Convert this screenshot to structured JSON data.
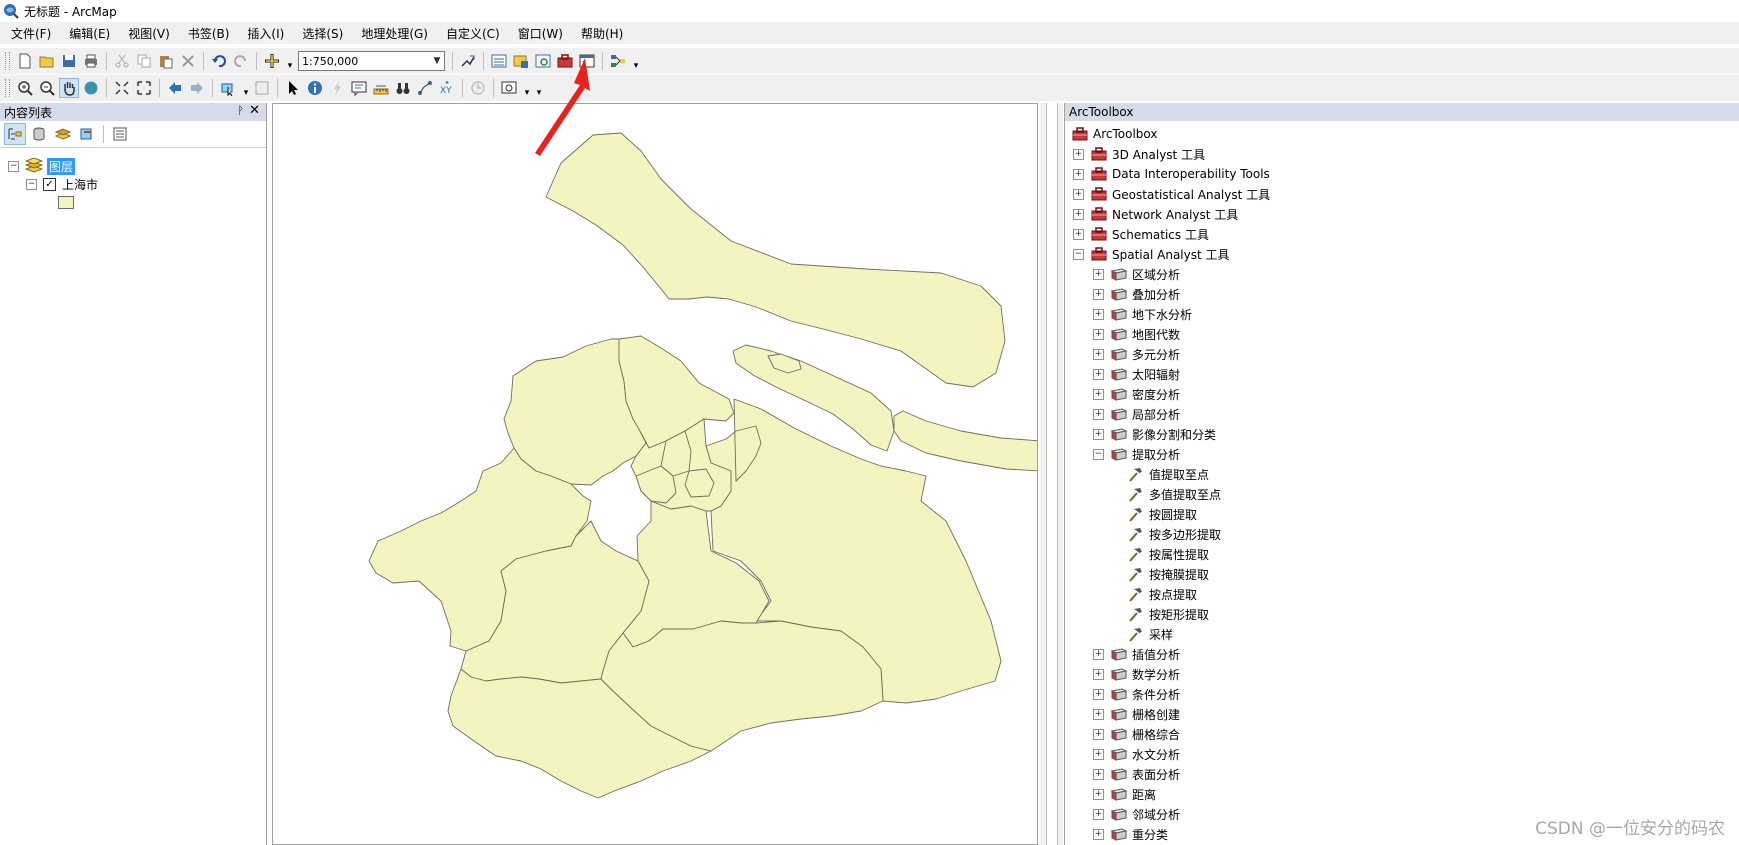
{
  "window": {
    "title": "无标题 - ArcMap"
  },
  "menu": [
    "文件(F)",
    "编辑(E)",
    "视图(V)",
    "书签(B)",
    "插入(I)",
    "选择(S)",
    "地理处理(G)",
    "自定义(C)",
    "窗口(W)",
    "帮助(H)"
  ],
  "toolbar": {
    "scale_value": "1:750,000"
  },
  "toc": {
    "title": "内容列表",
    "root_label": "图层",
    "layer_label": "上海市",
    "layer_checked": true
  },
  "toolbox": {
    "title": "ArcToolbox",
    "root_label": "ArcToolbox",
    "toolsets": [
      {
        "label": "3D Analyst 工具",
        "expanded": false
      },
      {
        "label": "Data Interoperability Tools",
        "expanded": false
      },
      {
        "label": "Geostatistical Analyst 工具",
        "expanded": false
      },
      {
        "label": "Network Analyst 工具",
        "expanded": false
      },
      {
        "label": "Schematics 工具",
        "expanded": false
      },
      {
        "label": "Spatial Analyst 工具",
        "expanded": true
      }
    ],
    "spatial_children": [
      {
        "label": "区域分析",
        "expanded": false
      },
      {
        "label": "叠加分析",
        "expanded": false
      },
      {
        "label": "地下水分析",
        "expanded": false
      },
      {
        "label": "地图代数",
        "expanded": false
      },
      {
        "label": "多元分析",
        "expanded": false
      },
      {
        "label": "太阳辐射",
        "expanded": false
      },
      {
        "label": "密度分析",
        "expanded": false
      },
      {
        "label": "局部分析",
        "expanded": false
      },
      {
        "label": "影像分割和分类",
        "expanded": false
      },
      {
        "label": "提取分析",
        "expanded": true
      }
    ],
    "extraction_tools": [
      "值提取至点",
      "多值提取至点",
      "按圆提取",
      "按多边形提取",
      "按属性提取",
      "按掩膜提取",
      "按点提取",
      "按矩形提取",
      "采样"
    ],
    "spatial_children_after": [
      {
        "label": "插值分析",
        "expanded": false
      },
      {
        "label": "数学分析",
        "expanded": false
      },
      {
        "label": "条件分析",
        "expanded": false
      },
      {
        "label": "栅格创建",
        "expanded": false
      },
      {
        "label": "栅格综合",
        "expanded": false
      },
      {
        "label": "水文分析",
        "expanded": false
      },
      {
        "label": "表面分析",
        "expanded": false
      },
      {
        "label": "距离",
        "expanded": false
      },
      {
        "label": "邻域分析",
        "expanded": false
      },
      {
        "label": "重分类",
        "expanded": false
      }
    ]
  },
  "map": {
    "fill_color": "#f4f4c1",
    "stroke_color": "#6e6e5a"
  },
  "annotation_color": "#e8231e",
  "watermark": "CSDN @一位安分的码农"
}
